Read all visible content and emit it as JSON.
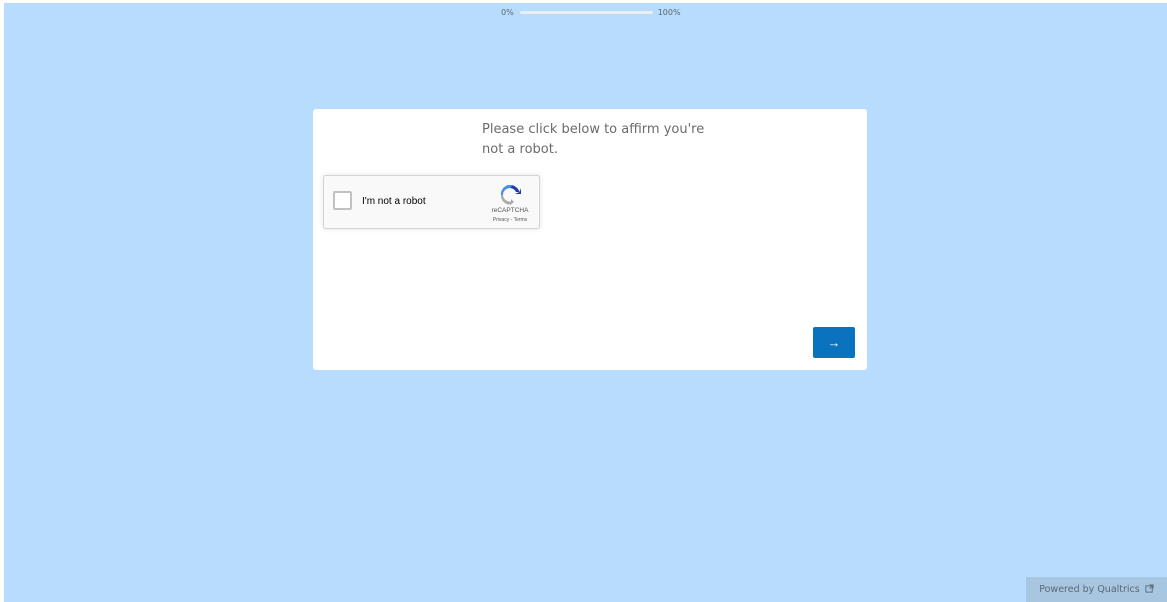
{
  "progress": {
    "start_label": "0%",
    "end_label": "100%",
    "value": 0
  },
  "question": {
    "text": "Please click below to affirm you're not a robot."
  },
  "recaptcha": {
    "checkbox_label": "I'm not a robot",
    "brand": "reCAPTCHA",
    "privacy_link": "Privacy",
    "separator": " - ",
    "terms_link": "Terms",
    "checked": false
  },
  "navigation": {
    "next_button_label": "→",
    "next_button_color": "#0a73bf"
  },
  "footer": {
    "powered_by": "Powered by Qualtrics",
    "external_icon": "external-link-icon"
  },
  "colors": {
    "page_background": "#b7dcfd",
    "card_background": "#ffffff",
    "accent": "#0a73bf"
  }
}
